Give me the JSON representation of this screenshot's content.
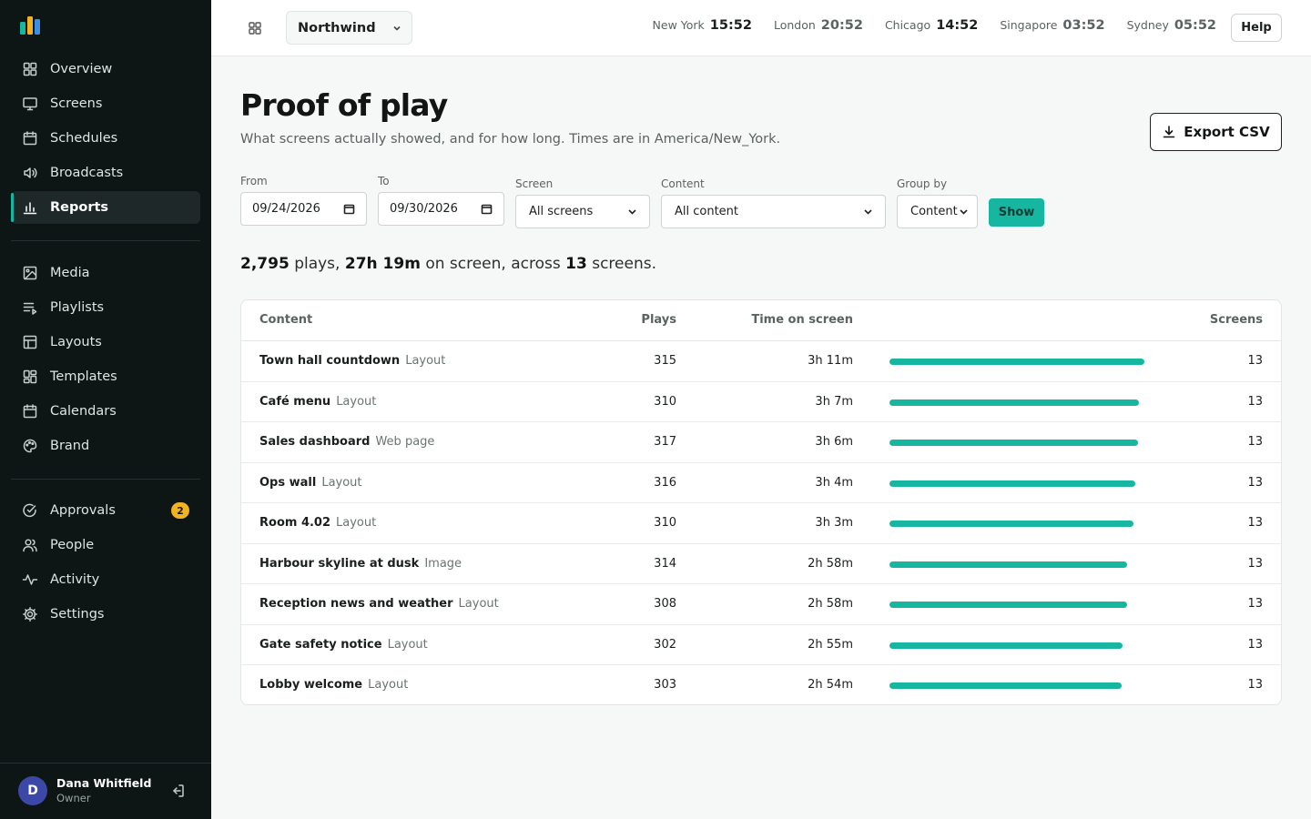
{
  "brand": {
    "accent": "#17b6a0",
    "logo_colors": [
      "#17b6a0",
      "#f2b320",
      "#3b8fe0"
    ]
  },
  "sidebar": {
    "groups": [
      [
        {
          "label": "Overview",
          "icon": "grid-icon"
        },
        {
          "label": "Screens",
          "icon": "monitor-icon"
        },
        {
          "label": "Schedules",
          "icon": "calendar-icon"
        },
        {
          "label": "Broadcasts",
          "icon": "speaker-icon"
        },
        {
          "label": "Reports",
          "icon": "bar-chart-icon",
          "active": true
        }
      ],
      [
        {
          "label": "Media",
          "icon": "image-icon"
        },
        {
          "label": "Playlists",
          "icon": "playlist-icon"
        },
        {
          "label": "Layouts",
          "icon": "layout-icon"
        },
        {
          "label": "Templates",
          "icon": "templates-icon"
        },
        {
          "label": "Calendars",
          "icon": "calendar-icon"
        },
        {
          "label": "Brand",
          "icon": "palette-icon"
        }
      ],
      [
        {
          "label": "Approvals",
          "icon": "check-circle-icon",
          "badge": "2"
        },
        {
          "label": "People",
          "icon": "people-icon"
        },
        {
          "label": "Activity",
          "icon": "activity-icon"
        },
        {
          "label": "Settings",
          "icon": "gear-icon"
        }
      ]
    ],
    "user": {
      "initial": "D",
      "name": "Dana Whitfield",
      "role": "Owner"
    }
  },
  "topbar": {
    "org": "Northwind",
    "clocks": [
      {
        "city": "New York",
        "time": "15:52",
        "emphasis": true
      },
      {
        "city": "London",
        "time": "20:52"
      },
      {
        "city": "Chicago",
        "time": "14:52",
        "emphasis": true
      },
      {
        "city": "Singapore",
        "time": "03:52"
      },
      {
        "city": "Sydney",
        "time": "05:52"
      }
    ],
    "help": "Help"
  },
  "page": {
    "title": "Proof of play",
    "subtitle": "What screens actually showed, and for how long. Times are in America/New_York.",
    "export": "Export CSV"
  },
  "filters": {
    "from_label": "From",
    "from_value": "09/24/2026",
    "to_label": "To",
    "to_value": "09/30/2026",
    "screen_label": "Screen",
    "screen_value": "All screens",
    "content_label": "Content",
    "content_value": "All content",
    "group_label": "Group by",
    "group_value": "Content",
    "show": "Show"
  },
  "summary": {
    "plays": "2,795",
    "plays_word": "plays,",
    "time": "27h 19m",
    "time_word": "on screen, across",
    "screens": "13",
    "screens_word": "screens."
  },
  "table": {
    "headers": {
      "content": "Content",
      "plays": "Plays",
      "time": "Time on screen",
      "screens": "Screens"
    },
    "rows": [
      {
        "name": "Town hall countdown",
        "type": "Layout",
        "plays": "315",
        "time": "3h 11m",
        "share": 1.0,
        "screens": "13"
      },
      {
        "name": "Café menu",
        "type": "Layout",
        "plays": "310",
        "time": "3h 7m",
        "share": 0.979,
        "screens": "13"
      },
      {
        "name": "Sales dashboard",
        "type": "Web page",
        "plays": "317",
        "time": "3h 6m",
        "share": 0.974,
        "screens": "13"
      },
      {
        "name": "Ops wall",
        "type": "Layout",
        "plays": "316",
        "time": "3h 4m",
        "share": 0.963,
        "screens": "13"
      },
      {
        "name": "Room 4.02",
        "type": "Layout",
        "plays": "310",
        "time": "3h 3m",
        "share": 0.958,
        "screens": "13"
      },
      {
        "name": "Harbour skyline at dusk",
        "type": "Image",
        "plays": "314",
        "time": "2h 58m",
        "share": 0.932,
        "screens": "13"
      },
      {
        "name": "Reception news and weather",
        "type": "Layout",
        "plays": "308",
        "time": "2h 58m",
        "share": 0.932,
        "screens": "13"
      },
      {
        "name": "Gate safety notice",
        "type": "Layout",
        "plays": "302",
        "time": "2h 55m",
        "share": 0.916,
        "screens": "13"
      },
      {
        "name": "Lobby welcome",
        "type": "Layout",
        "plays": "303",
        "time": "2h 54m",
        "share": 0.911,
        "screens": "13"
      }
    ]
  }
}
